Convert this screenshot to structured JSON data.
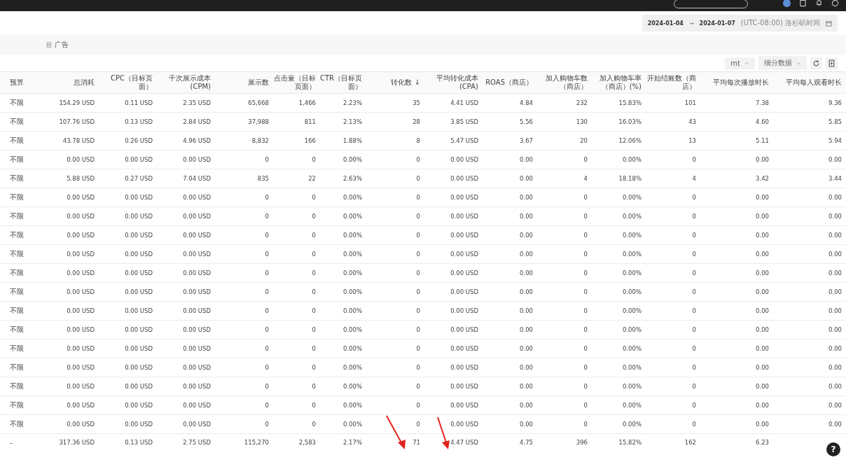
{
  "date_range": {
    "start": "2024-01-04",
    "separator": "→",
    "end": "2024-01-07",
    "timezone": "(UTC-08:00) 洛杉矶时间"
  },
  "breadcrumb": {
    "label": "广告"
  },
  "toolbar": {
    "dropdowns": [
      "mt",
      "细分数据"
    ]
  },
  "table": {
    "columns": [
      "预算",
      "总消耗",
      "CPC（目标页面）",
      "千次展示成本 (CPM)",
      "展示数",
      "点击量（目标页面）",
      "CTR（目标页面）",
      "转化数 ↓",
      "平均转化成本 (CPA)",
      "ROAS（商店）",
      "加入购物车数（商店）",
      "加入购物车率（商店）(%)",
      "开始结账数（商店）",
      "平均每次播放时长",
      "平均每人观看时长"
    ],
    "rows": [
      [
        "不限",
        "154.29 USD",
        "0.11 USD",
        "2.35 USD",
        "65,668",
        "1,466",
        "2.23%",
        "35",
        "4.41 USD",
        "4.84",
        "232",
        "15.83%",
        "101",
        "7.38",
        "9.36"
      ],
      [
        "不限",
        "107.76 USD",
        "0.13 USD",
        "2.84 USD",
        "37,988",
        "811",
        "2.13%",
        "28",
        "3.85 USD",
        "5.56",
        "130",
        "16.03%",
        "43",
        "4.60",
        "5.85"
      ],
      [
        "不限",
        "43.78 USD",
        "0.26 USD",
        "4.96 USD",
        "8,832",
        "166",
        "1.88%",
        "8",
        "5.47 USD",
        "3.67",
        "20",
        "12.06%",
        "13",
        "5.11",
        "5.94"
      ],
      [
        "不限",
        "0.00 USD",
        "0.00 USD",
        "0.00 USD",
        "0",
        "0",
        "0.00%",
        "0",
        "0.00 USD",
        "0.00",
        "0",
        "0.00%",
        "0",
        "0.00",
        "0.00"
      ],
      [
        "不限",
        "5.88 USD",
        "0.27 USD",
        "7.04 USD",
        "835",
        "22",
        "2.63%",
        "0",
        "0.00 USD",
        "0.00",
        "4",
        "18.18%",
        "4",
        "3.42",
        "3.44"
      ],
      [
        "不限",
        "0.00 USD",
        "0.00 USD",
        "0.00 USD",
        "0",
        "0",
        "0.00%",
        "0",
        "0.00 USD",
        "0.00",
        "0",
        "0.00%",
        "0",
        "0.00",
        "0.00"
      ],
      [
        "不限",
        "0.00 USD",
        "0.00 USD",
        "0.00 USD",
        "0",
        "0",
        "0.00%",
        "0",
        "0.00 USD",
        "0.00",
        "0",
        "0.00%",
        "0",
        "0.00",
        "0.00"
      ],
      [
        "不限",
        "0.00 USD",
        "0.00 USD",
        "0.00 USD",
        "0",
        "0",
        "0.00%",
        "0",
        "0.00 USD",
        "0.00",
        "0",
        "0.00%",
        "0",
        "0.00",
        "0.00"
      ],
      [
        "不限",
        "0.00 USD",
        "0.00 USD",
        "0.00 USD",
        "0",
        "0",
        "0.00%",
        "0",
        "0.00 USD",
        "0.00",
        "0",
        "0.00%",
        "0",
        "0.00",
        "0.00"
      ],
      [
        "不限",
        "0.00 USD",
        "0.00 USD",
        "0.00 USD",
        "0",
        "0",
        "0.00%",
        "0",
        "0.00 USD",
        "0.00",
        "0",
        "0.00%",
        "0",
        "0.00",
        "0.00"
      ],
      [
        "不限",
        "0.00 USD",
        "0.00 USD",
        "0.00 USD",
        "0",
        "0",
        "0.00%",
        "0",
        "0.00 USD",
        "0.00",
        "0",
        "0.00%",
        "0",
        "0.00",
        "0.00"
      ],
      [
        "不限",
        "0.00 USD",
        "0.00 USD",
        "0.00 USD",
        "0",
        "0",
        "0.00%",
        "0",
        "0.00 USD",
        "0.00",
        "0",
        "0.00%",
        "0",
        "0.00",
        "0.00"
      ],
      [
        "不限",
        "0.00 USD",
        "0.00 USD",
        "0.00 USD",
        "0",
        "0",
        "0.00%",
        "0",
        "0.00 USD",
        "0.00",
        "0",
        "0.00%",
        "0",
        "0.00",
        "0.00"
      ],
      [
        "不限",
        "0.00 USD",
        "0.00 USD",
        "0.00 USD",
        "0",
        "0",
        "0.00%",
        "0",
        "0.00 USD",
        "0.00",
        "0",
        "0.00%",
        "0",
        "0.00",
        "0.00"
      ],
      [
        "不限",
        "0.00 USD",
        "0.00 USD",
        "0.00 USD",
        "0",
        "0",
        "0.00%",
        "0",
        "0.00 USD",
        "0.00",
        "0",
        "0.00%",
        "0",
        "0.00",
        "0.00"
      ],
      [
        "不限",
        "0.00 USD",
        "0.00 USD",
        "0.00 USD",
        "0",
        "0",
        "0.00%",
        "0",
        "0.00 USD",
        "0.00",
        "0",
        "0.00%",
        "0",
        "0.00",
        "0.00"
      ],
      [
        "不限",
        "0.00 USD",
        "0.00 USD",
        "0.00 USD",
        "0",
        "0",
        "0.00%",
        "0",
        "0.00 USD",
        "0.00",
        "0",
        "0.00%",
        "0",
        "0.00",
        "0.00"
      ],
      [
        "不限",
        "0.00 USD",
        "0.00 USD",
        "0.00 USD",
        "0",
        "0",
        "0.00%",
        "0",
        "0.00 USD",
        "0.00",
        "0",
        "0.00%",
        "0",
        "0.00",
        "0.00"
      ]
    ],
    "totals": [
      "-",
      "317.36 USD",
      "0.13 USD",
      "2.75 USD",
      "115,270",
      "2,583",
      "2.17%",
      "71",
      "4.47 USD",
      "4.75",
      "396",
      "15.82%",
      "162",
      "6.23"
    ]
  },
  "help_button": {
    "label": "?"
  }
}
